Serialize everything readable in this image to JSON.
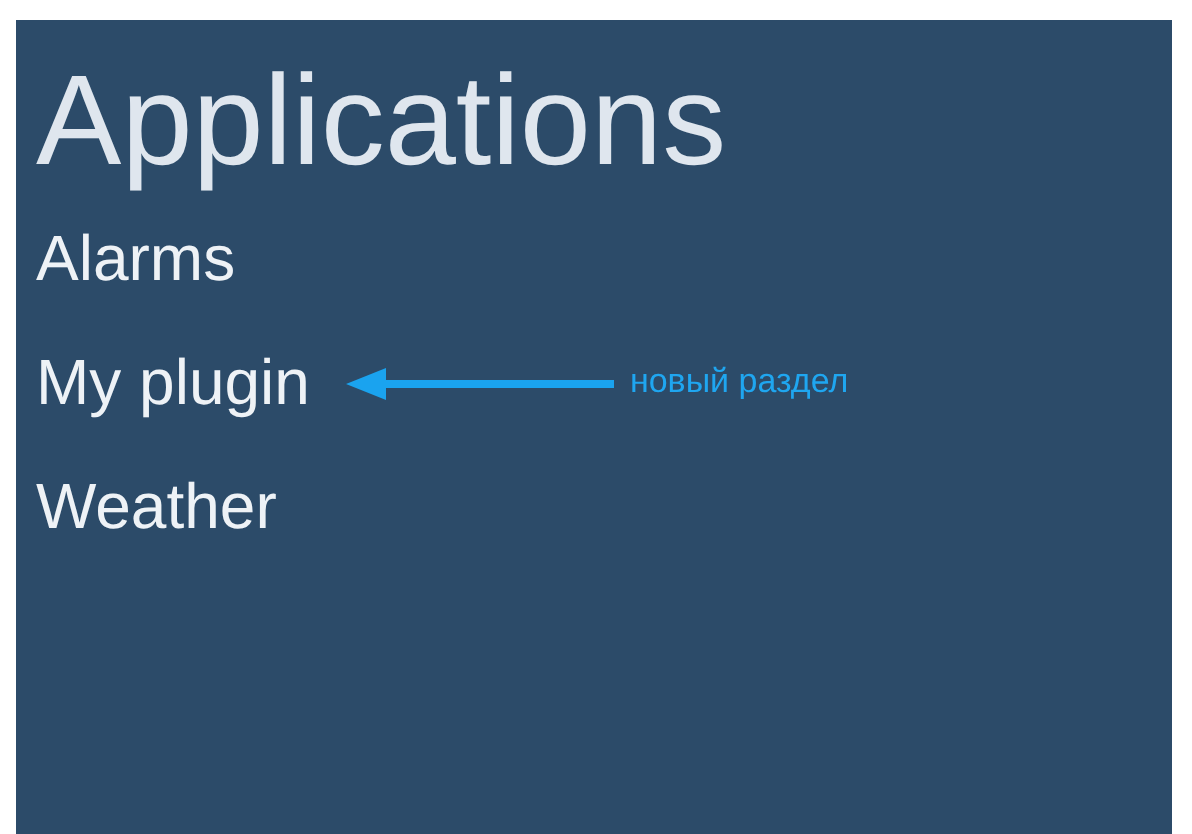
{
  "title": "Applications",
  "items": [
    {
      "label": "Alarms"
    },
    {
      "label": "My plugin",
      "note": "новый раздел"
    },
    {
      "label": "Weather"
    }
  ]
}
